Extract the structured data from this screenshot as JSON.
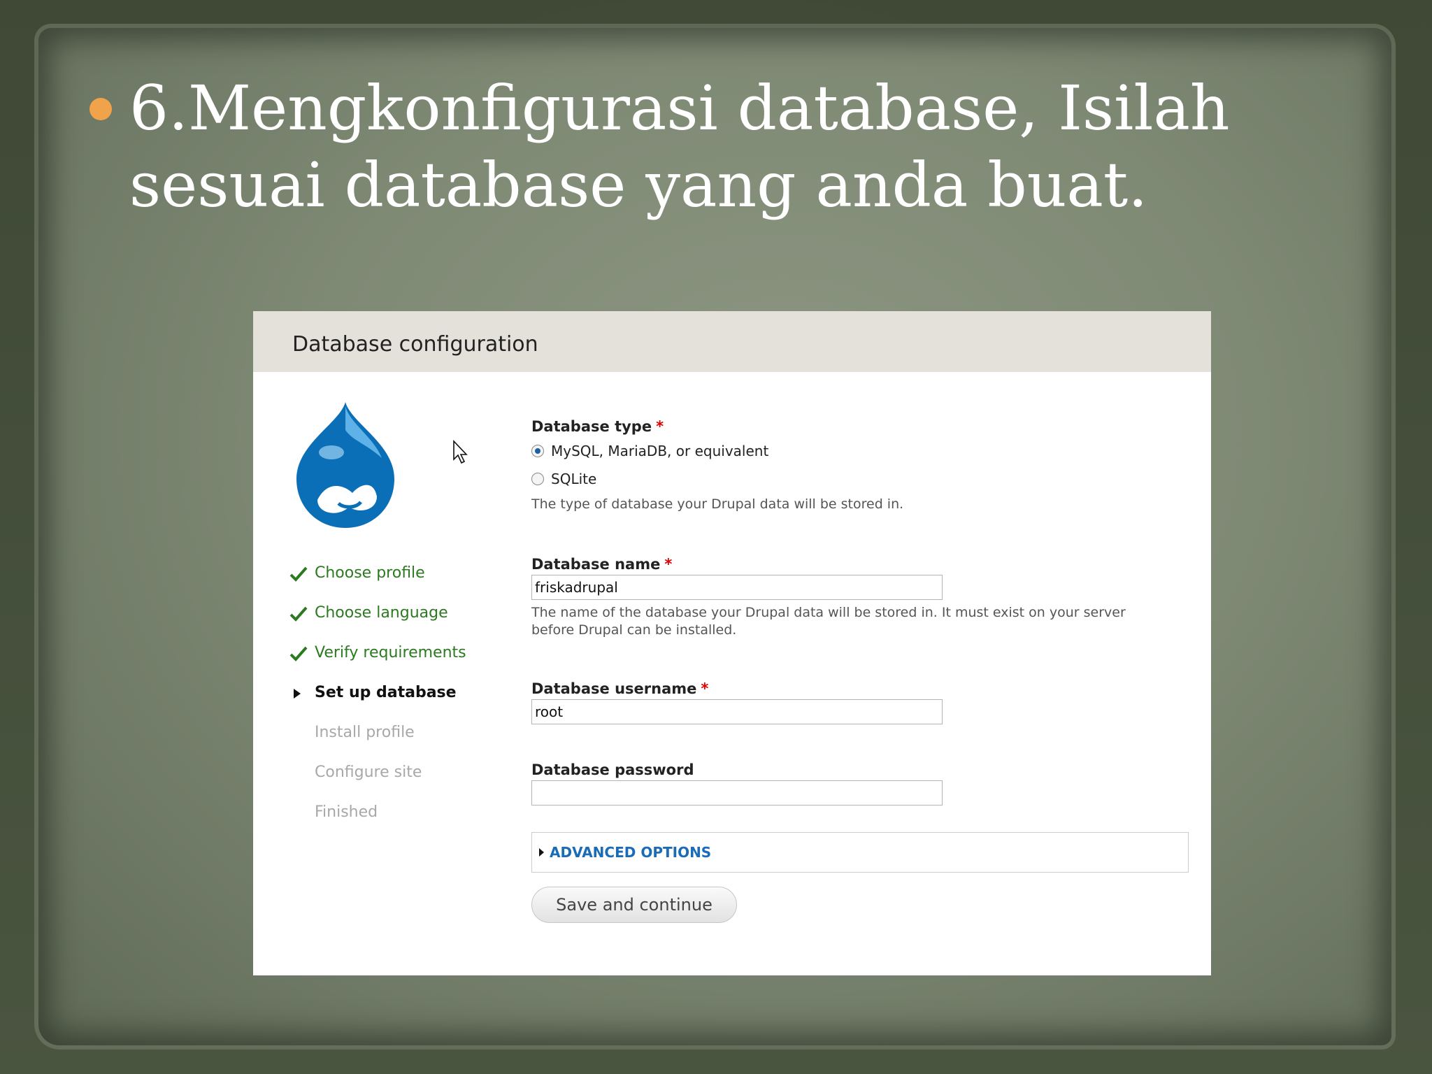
{
  "slide": {
    "title": "6.Mengkonfigurasi database, Isilah sesuai database yang anda buat.",
    "bullet_color": "#f0a34a"
  },
  "panel": {
    "heading": "Database configuration",
    "logo_icon": "drupal-drop-icon"
  },
  "steps": [
    {
      "label": "Choose profile",
      "status": "done"
    },
    {
      "label": "Choose language",
      "status": "done"
    },
    {
      "label": "Verify requirements",
      "status": "done"
    },
    {
      "label": "Set up database",
      "status": "active"
    },
    {
      "label": "Install profile",
      "status": "todo"
    },
    {
      "label": "Configure site",
      "status": "todo"
    },
    {
      "label": "Finished",
      "status": "todo"
    }
  ],
  "form": {
    "db_type": {
      "label": "Database type",
      "required_mark": "*",
      "options": [
        "MySQL, MariaDB, or equivalent",
        "SQLite"
      ],
      "selected": "MySQL, MariaDB, or equivalent",
      "description": "The type of database your Drupal data will be stored in."
    },
    "db_name": {
      "label": "Database name",
      "required_mark": "*",
      "value": "friskadrupal",
      "description": "The name of the database your Drupal data will be stored in. It must exist on your server before Drupal can be installed."
    },
    "db_username": {
      "label": "Database username",
      "required_mark": "*",
      "value": "root"
    },
    "db_password": {
      "label": "Database password",
      "value": ""
    },
    "advanced_label": "ADVANCED OPTIONS",
    "save_label": "Save and continue"
  },
  "colors": {
    "done": "#2b7a1f",
    "link": "#1a6bb8",
    "required": "#dd0000"
  }
}
